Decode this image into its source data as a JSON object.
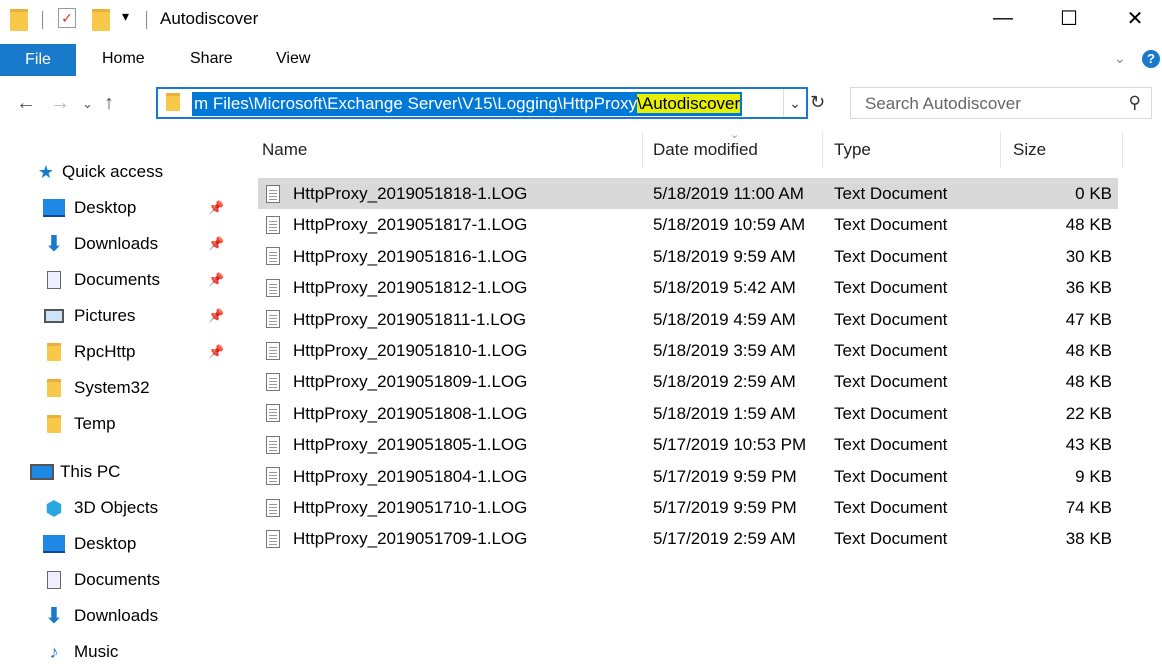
{
  "window": {
    "title": "Autodiscover",
    "controls": {
      "minimize": "—",
      "maximize": "☐",
      "close": "✕"
    }
  },
  "ribbon": {
    "file": "File",
    "tabs": [
      "Home",
      "Share",
      "View"
    ]
  },
  "address": {
    "path_prefix": "m Files\\Microsoft\\Exchange Server\\V15\\Logging\\HttpProxy",
    "path_highlight": "\\Autodiscover"
  },
  "search": {
    "placeholder": "Search Autodiscover"
  },
  "sidebar": {
    "quick_access": "Quick access",
    "items": [
      {
        "label": "Desktop",
        "icon": "desktop-icon",
        "pinned": true
      },
      {
        "label": "Downloads",
        "icon": "download-icon",
        "pinned": true
      },
      {
        "label": "Documents",
        "icon": "documents-icon",
        "pinned": true
      },
      {
        "label": "Pictures",
        "icon": "pictures-icon",
        "pinned": true
      },
      {
        "label": "RpcHttp",
        "icon": "folder-icon",
        "pinned": true
      },
      {
        "label": "System32",
        "icon": "folder-icon",
        "pinned": false
      },
      {
        "label": "Temp",
        "icon": "folder-icon",
        "pinned": false
      }
    ],
    "this_pc": "This PC",
    "pc_items": [
      {
        "label": "3D Objects",
        "icon": "3d-objects-icon"
      },
      {
        "label": "Desktop",
        "icon": "desktop-icon"
      },
      {
        "label": "Documents",
        "icon": "documents-icon"
      },
      {
        "label": "Downloads",
        "icon": "download-icon"
      },
      {
        "label": "Music",
        "icon": "music-icon"
      }
    ]
  },
  "columns": {
    "name": "Name",
    "date": "Date modified",
    "type": "Type",
    "size": "Size"
  },
  "files": [
    {
      "name": "HttpProxy_2019051818-1.LOG",
      "date": "5/18/2019 11:00 AM",
      "type": "Text Document",
      "size": "0 KB"
    },
    {
      "name": "HttpProxy_2019051817-1.LOG",
      "date": "5/18/2019 10:59 AM",
      "type": "Text Document",
      "size": "48 KB"
    },
    {
      "name": "HttpProxy_2019051816-1.LOG",
      "date": "5/18/2019 9:59 AM",
      "type": "Text Document",
      "size": "30 KB"
    },
    {
      "name": "HttpProxy_2019051812-1.LOG",
      "date": "5/18/2019 5:42 AM",
      "type": "Text Document",
      "size": "36 KB"
    },
    {
      "name": "HttpProxy_2019051811-1.LOG",
      "date": "5/18/2019 4:59 AM",
      "type": "Text Document",
      "size": "47 KB"
    },
    {
      "name": "HttpProxy_2019051810-1.LOG",
      "date": "5/18/2019 3:59 AM",
      "type": "Text Document",
      "size": "48 KB"
    },
    {
      "name": "HttpProxy_2019051809-1.LOG",
      "date": "5/18/2019 2:59 AM",
      "type": "Text Document",
      "size": "48 KB"
    },
    {
      "name": "HttpProxy_2019051808-1.LOG",
      "date": "5/18/2019 1:59 AM",
      "type": "Text Document",
      "size": "22 KB"
    },
    {
      "name": "HttpProxy_2019051805-1.LOG",
      "date": "5/17/2019 10:53 PM",
      "type": "Text Document",
      "size": "43 KB"
    },
    {
      "name": "HttpProxy_2019051804-1.LOG",
      "date": "5/17/2019 9:59 PM",
      "type": "Text Document",
      "size": "9 KB"
    },
    {
      "name": "HttpProxy_2019051710-1.LOG",
      "date": "5/17/2019 9:59 PM",
      "type": "Text Document",
      "size": "74 KB"
    },
    {
      "name": "HttpProxy_2019051709-1.LOG",
      "date": "5/17/2019 2:59 AM",
      "type": "Text Document",
      "size": "38 KB"
    }
  ],
  "colors": {
    "accent": "#1979ca",
    "selection": "#0078d7",
    "highlight": "#e6f000",
    "folder": "#f7c84a"
  }
}
